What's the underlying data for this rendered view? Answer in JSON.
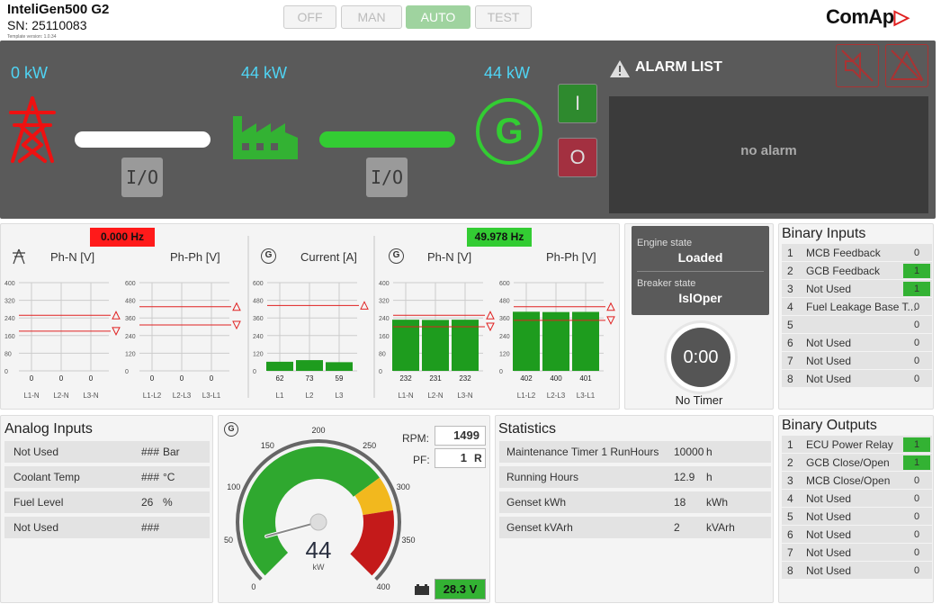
{
  "header": {
    "model": "InteliGen500 G2",
    "serial": "SN: 25110083",
    "template_version": "Template version: 1.0.34",
    "brand": "ComAp",
    "modes": [
      {
        "label": "OFF",
        "active": false
      },
      {
        "label": "MAN",
        "active": false
      },
      {
        "label": "AUTO",
        "active": true
      },
      {
        "label": "TEST",
        "active": false
      }
    ]
  },
  "sld": {
    "mains_kw": "0 kW",
    "load_kw": "44 kW",
    "gen_kw": "44 kW",
    "mcb_label": "I/O",
    "gcb_label": "I/O",
    "gen_letter": "G",
    "start_label": "I",
    "stop_label": "O",
    "alarm_title": "ALARM LIST",
    "alarm_text": "no alarm"
  },
  "mains": {
    "freq": "0.000 Hz",
    "phn_title": "Ph-N [V]",
    "phph_title": "Ph-Ph [V]",
    "axis": [
      "400",
      "320",
      "240",
      "160",
      "80",
      "0"
    ],
    "axis2": [
      "600",
      "480",
      "360",
      "240",
      "120",
      "0"
    ],
    "phn_values": [
      0,
      0,
      0
    ],
    "phph_values": [
      0,
      0,
      0
    ],
    "phn_labels": [
      "L1-N",
      "L2-N",
      "L3-N"
    ],
    "phph_labels": [
      "L1-L2",
      "L2-L3",
      "L3-L1"
    ]
  },
  "current": {
    "title": "Current [A]",
    "axis": [
      "600",
      "480",
      "360",
      "240",
      "120",
      "0"
    ],
    "values": [
      62,
      73,
      59
    ],
    "labels": [
      "L1",
      "L2",
      "L3"
    ]
  },
  "gen": {
    "freq": "49.978 Hz",
    "phn_title": "Ph-N [V]",
    "phph_title": "Ph-Ph [V]",
    "phn_axis": [
      "400",
      "320",
      "240",
      "160",
      "80",
      "0"
    ],
    "phph_axis": [
      "600",
      "480",
      "360",
      "240",
      "120",
      "0"
    ],
    "phn_values": [
      232,
      231,
      232
    ],
    "phph_values": [
      402,
      400,
      401
    ],
    "phn_labels": [
      "L1-N",
      "L2-N",
      "L3-N"
    ],
    "phph_labels": [
      "L1-L2",
      "L2-L3",
      "L3-L1"
    ]
  },
  "engine": {
    "state_label": "Engine state",
    "state": "Loaded",
    "breaker_label": "Breaker state",
    "breaker": "IslOper",
    "timer": "0:00",
    "timer_label": "No Timer"
  },
  "binary_inputs": {
    "title": "Binary Inputs",
    "rows": [
      {
        "n": "1",
        "name": "MCB Feedback",
        "val": "0",
        "on": false
      },
      {
        "n": "2",
        "name": "GCB Feedback",
        "val": "1",
        "on": true
      },
      {
        "n": "3",
        "name": "Not Used",
        "val": "1",
        "on": true
      },
      {
        "n": "4",
        "name": "Fuel Leakage Base T...",
        "val": "0",
        "on": false
      },
      {
        "n": "5",
        "name": "",
        "val": "0",
        "on": false
      },
      {
        "n": "6",
        "name": "Not Used",
        "val": "0",
        "on": false
      },
      {
        "n": "7",
        "name": "Not Used",
        "val": "0",
        "on": false
      },
      {
        "n": "8",
        "name": "Not Used",
        "val": "0",
        "on": false
      }
    ]
  },
  "binary_outputs": {
    "title": "Binary Outputs",
    "rows": [
      {
        "n": "1",
        "name": "ECU Power Relay",
        "val": "1",
        "on": true
      },
      {
        "n": "2",
        "name": "GCB Close/Open",
        "val": "1",
        "on": true
      },
      {
        "n": "3",
        "name": "MCB Close/Open",
        "val": "0",
        "on": false
      },
      {
        "n": "4",
        "name": "Not Used",
        "val": "0",
        "on": false
      },
      {
        "n": "5",
        "name": "Not Used",
        "val": "0",
        "on": false
      },
      {
        "n": "6",
        "name": "Not Used",
        "val": "0",
        "on": false
      },
      {
        "n": "7",
        "name": "Not Used",
        "val": "0",
        "on": false
      },
      {
        "n": "8",
        "name": "Not Used",
        "val": "0",
        "on": false
      }
    ]
  },
  "analog_inputs": {
    "title": "Analog Inputs",
    "rows": [
      {
        "name": "Not Used",
        "val": "###",
        "unit": "Bar"
      },
      {
        "name": "Coolant Temp",
        "val": "###",
        "unit": "°C"
      },
      {
        "name": "Fuel Level",
        "val": "26",
        "unit": "%"
      },
      {
        "name": "Not Used",
        "val": "###",
        "unit": ""
      }
    ]
  },
  "gauge": {
    "value": "44",
    "unit": "kW",
    "ticks": [
      "0",
      "50",
      "100",
      "150",
      "200",
      "250",
      "300",
      "350",
      "400"
    ],
    "rpm_label": "RPM:",
    "rpm": "1499",
    "pf_label": "PF:",
    "pf": "1",
    "pf_suffix": "R",
    "battery": "28.3 V",
    "gen_letter": "G"
  },
  "statistics": {
    "title": "Statistics",
    "rows": [
      {
        "name": "Maintenance Timer 1 RunHours",
        "val": "10000",
        "unit": "h"
      },
      {
        "name": "Running Hours",
        "val": "12.9",
        "unit": "h"
      },
      {
        "name": "Genset kWh",
        "val": "18",
        "unit": "kWh"
      },
      {
        "name": "Genset kVArh",
        "val": "2",
        "unit": "kVArh"
      }
    ]
  },
  "colors": {
    "green": "#33b233",
    "cyan": "#4fd4f4",
    "red": "#e02020",
    "alarm_red": "#ff1a1a",
    "dark": "#5a5a5a"
  }
}
